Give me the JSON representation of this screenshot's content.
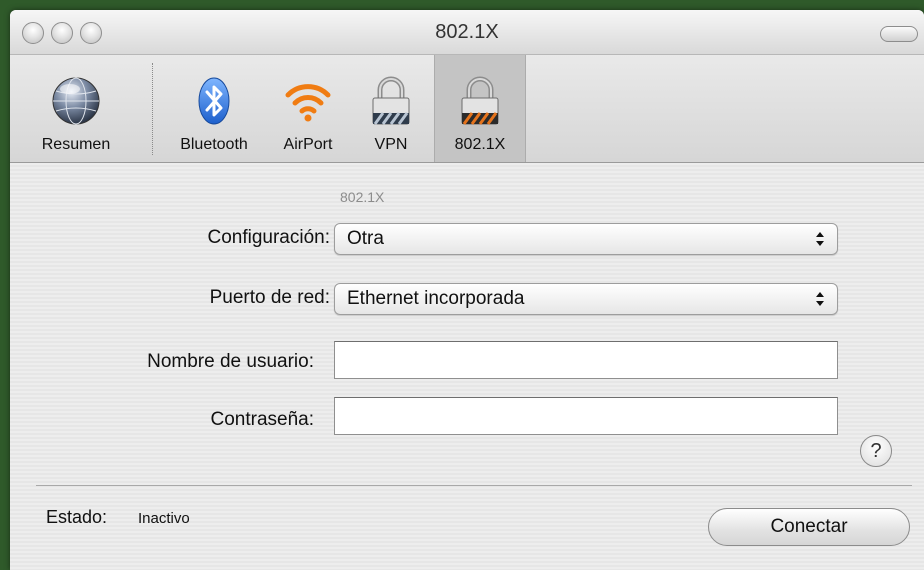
{
  "window": {
    "title": "802.1X"
  },
  "toolbar": {
    "items": [
      {
        "label": "Resumen",
        "icon": "network-globe-icon"
      },
      {
        "label": "Bluetooth",
        "icon": "bluetooth-icon"
      },
      {
        "label": "AirPort",
        "icon": "airport-wifi-icon"
      },
      {
        "label": "VPN",
        "icon": "vpn-lock-icon"
      },
      {
        "label": "802.1X",
        "icon": "8021x-lock-icon",
        "selected": true
      }
    ]
  },
  "form": {
    "section_label": "802.1X",
    "configuracion": {
      "label": "Configuración:",
      "value": "Otra"
    },
    "puerto": {
      "label": "Puerto de red:",
      "value": "Ethernet incorporada"
    },
    "usuario": {
      "label": "Nombre de usuario:",
      "value": ""
    },
    "contrasena": {
      "label": "Contraseña:",
      "value": ""
    },
    "help_symbol": "?"
  },
  "status": {
    "label": "Estado:",
    "value": "Inactivo"
  },
  "actions": {
    "connect_label": "Conectar"
  },
  "colors": {
    "airport_orange": "#f07c12",
    "bluetooth_blue": "#2f7ee8",
    "caution_orange": "#e5731c"
  }
}
